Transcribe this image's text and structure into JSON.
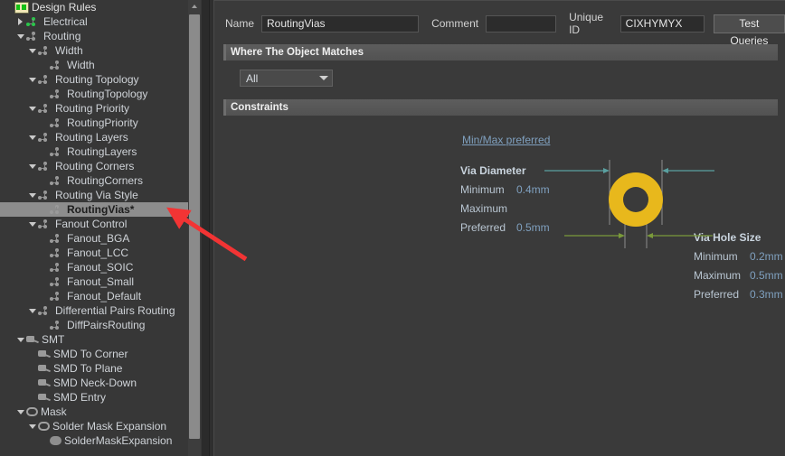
{
  "tree": {
    "title": "Design Rules",
    "items": [
      {
        "label": "Design Rules",
        "depth": 0,
        "icon": "design-rules-icon",
        "twisty": "",
        "selected": false,
        "root": true
      },
      {
        "label": "Electrical",
        "depth": 1,
        "icon": "net-green-icon",
        "twisty": "closed",
        "selected": false
      },
      {
        "label": "Routing",
        "depth": 1,
        "icon": "net-icon",
        "twisty": "open",
        "selected": false
      },
      {
        "label": "Width",
        "depth": 2,
        "icon": "net-icon",
        "twisty": "open",
        "selected": false
      },
      {
        "label": "Width",
        "depth": 3,
        "icon": "net-icon",
        "twisty": "",
        "selected": false
      },
      {
        "label": "Routing Topology",
        "depth": 2,
        "icon": "net-icon",
        "twisty": "open",
        "selected": false
      },
      {
        "label": "RoutingTopology",
        "depth": 3,
        "icon": "net-icon",
        "twisty": "",
        "selected": false
      },
      {
        "label": "Routing Priority",
        "depth": 2,
        "icon": "net-icon",
        "twisty": "open",
        "selected": false
      },
      {
        "label": "RoutingPriority",
        "depth": 3,
        "icon": "net-icon",
        "twisty": "",
        "selected": false
      },
      {
        "label": "Routing Layers",
        "depth": 2,
        "icon": "net-icon",
        "twisty": "open",
        "selected": false
      },
      {
        "label": "RoutingLayers",
        "depth": 3,
        "icon": "net-icon",
        "twisty": "",
        "selected": false
      },
      {
        "label": "Routing Corners",
        "depth": 2,
        "icon": "net-icon",
        "twisty": "open",
        "selected": false
      },
      {
        "label": "RoutingCorners",
        "depth": 3,
        "icon": "net-icon",
        "twisty": "",
        "selected": false
      },
      {
        "label": "Routing Via Style",
        "depth": 2,
        "icon": "net-icon",
        "twisty": "open",
        "selected": false
      },
      {
        "label": "RoutingVias*",
        "depth": 3,
        "icon": "net-icon",
        "twisty": "",
        "selected": true
      },
      {
        "label": "Fanout Control",
        "depth": 2,
        "icon": "net-icon",
        "twisty": "open",
        "selected": false
      },
      {
        "label": "Fanout_BGA",
        "depth": 3,
        "icon": "net-icon",
        "twisty": "",
        "selected": false
      },
      {
        "label": "Fanout_LCC",
        "depth": 3,
        "icon": "net-icon",
        "twisty": "",
        "selected": false
      },
      {
        "label": "Fanout_SOIC",
        "depth": 3,
        "icon": "net-icon",
        "twisty": "",
        "selected": false
      },
      {
        "label": "Fanout_Small",
        "depth": 3,
        "icon": "net-icon",
        "twisty": "",
        "selected": false
      },
      {
        "label": "Fanout_Default",
        "depth": 3,
        "icon": "net-icon",
        "twisty": "",
        "selected": false
      },
      {
        "label": "Differential Pairs Routing",
        "depth": 2,
        "icon": "net-icon",
        "twisty": "open",
        "selected": false
      },
      {
        "label": "DiffPairsRouting",
        "depth": 3,
        "icon": "net-icon",
        "twisty": "",
        "selected": false
      },
      {
        "label": "SMT",
        "depth": 1,
        "icon": "pad-icon",
        "twisty": "open",
        "selected": false
      },
      {
        "label": "SMD To Corner",
        "depth": 2,
        "icon": "pad-icon",
        "twisty": "",
        "selected": false
      },
      {
        "label": "SMD To Plane",
        "depth": 2,
        "icon": "pad-icon",
        "twisty": "",
        "selected": false
      },
      {
        "label": "SMD Neck-Down",
        "depth": 2,
        "icon": "pad-icon",
        "twisty": "",
        "selected": false
      },
      {
        "label": "SMD Entry",
        "depth": 2,
        "icon": "pad-icon",
        "twisty": "",
        "selected": false
      },
      {
        "label": "Mask",
        "depth": 1,
        "icon": "mask-icon",
        "twisty": "open",
        "selected": false
      },
      {
        "label": "Solder Mask Expansion",
        "depth": 2,
        "icon": "mask-icon",
        "twisty": "open",
        "selected": false
      },
      {
        "label": "SolderMaskExpansion",
        "depth": 3,
        "icon": "mask-filled-icon",
        "twisty": "",
        "selected": false
      }
    ]
  },
  "header": {
    "name_label": "Name",
    "name_value": "RoutingVias",
    "comment_label": "Comment",
    "comment_value": "",
    "comment_placeholder": "",
    "unique_id_label": "Unique ID",
    "unique_id_value": "CIXHYMYX",
    "test_queries_label": "Test Queries"
  },
  "where_section": {
    "title": "Where The Object Matches",
    "scope_value": "All",
    "scope_options": [
      "All"
    ]
  },
  "constraints_section": {
    "title": "Constraints",
    "minmax_link": "Min/Max preferred",
    "via_diameter": {
      "title": "Via Diameter",
      "minimum_label": "Minimum",
      "minimum_value": "0.4mm",
      "maximum_label": "Maximum",
      "maximum_value": "",
      "preferred_label": "Preferred",
      "preferred_value": "0.5mm"
    },
    "via_hole_size": {
      "title": "Via Hole Size",
      "minimum_label": "Minimum",
      "minimum_value": "0.2mm",
      "maximum_label": "Maximum",
      "maximum_value": "0.5mm",
      "preferred_label": "Preferred",
      "preferred_value": "0.3mm"
    }
  },
  "colors": {
    "via_copper": "#e8b81c",
    "diameter_dim": "#5aa0a0",
    "hole_dim": "#7a9a3a",
    "value_text": "#7fa0bf",
    "annotation_arrow": "#f23434",
    "selection": "#8d8d8d"
  }
}
